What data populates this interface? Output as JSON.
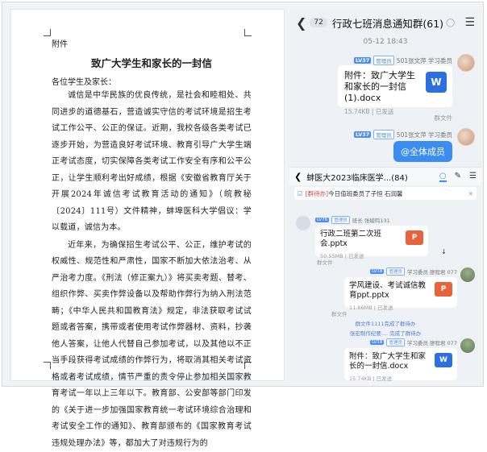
{
  "document": {
    "attachment_label": "附件",
    "title": "致广大学生和家长的一封信",
    "greeting": "各位学生及家长：",
    "paragraphs": [
      "诚信是中华民族的优良传统，是社会和睦相处、共同进步的道德基石，营造诚实守信的考试环境是招生考试工作公平、公正的保证。近期，我校各级各类考试已逐步开始，为营造良好考试环境、教育引导广大学生端正考试态度，切实保障各类考试工作安全有序和公平公正，让学生顺利考出好成绩，根据《安徽省教育厅关于开展2024年诚信考试教育活动的通知》（皖教秘〔2024〕111号）文件精神，蚌埠医科大学倡议：学以载道，诚信为本。",
      "近年来，为确保招生考试公平、公正，维护考试的权威性、规范性和严肃性，国家不断加大依法治考、从严治考力度。《刑法（修正案九）》将买卖考题、替考、组织作弊、买卖作弊设备以及帮助作弊行为纳入刑法范畴；《中华人民共和国教育法》规定，非法获取考试试题或者答案，携带或者使用考试作弊器材、资料，抄袭他人答案，让他人代替自己参加考试，以及其他以不正当手段获得考试成绩的作弊行为，将取消其相关考试资格或者考试成绩，情节严重的责令停止参加相关国家教育考试一年以上三年以下。教育部、公安部等部门印发的《关于进一步加强国家教育统一考试环境综合治理和考试安全工作的通知》、教育部颁布的《国家教育考试违规处理办法》等，都加大了对违规行为的"
    ]
  },
  "chat1": {
    "unread": "72",
    "title": "行政七班消息通知群(61)",
    "timestamp": "05-12 18:43",
    "sender": {
      "level": "LV37",
      "role": "管理员",
      "name": "501张文萍 学习委员"
    },
    "file": {
      "name": "附件：致广大学生和家长的一封信(1).docx",
      "size": "15.74KB",
      "status": "已发送"
    },
    "group_file_label": "群文件",
    "mention": "@全体成员"
  },
  "chat2": {
    "title": "蚌医大2023临床医学...(84)",
    "notice": {
      "tag": "[群待办]",
      "text": "今日值班委员了子恒 石润馨"
    },
    "msg1": {
      "level": "LV76",
      "role": "管理员",
      "name": "班长 张峻鸣131",
      "file_name": "行政二班第二次班会.pptx",
      "size": "50.55MB",
      "status": "已发送"
    },
    "group_file": "群文件",
    "msg2": {
      "level": "LV18",
      "role": "管理员",
      "name": "学习委员 廖程君 077",
      "file_name": "学风建设、考试诚信教育ppt.pptx",
      "size": "11.66MB",
      "status": "已发送"
    },
    "sys1": "群文件1111完成了群待办",
    "sys2": "张宏制作纪要.... 完成了群待办",
    "msg3": {
      "level": "LV18",
      "role": "管理员",
      "name": "学习委员 廖程君 077",
      "file_name": "附件：致广大学生和家长的一封信.docx",
      "size": "15.74KB",
      "status": "已发送"
    }
  },
  "colors": {
    "accent": "#3b8ef0",
    "word": "#2c6fe0",
    "ppt": "#e8623c"
  }
}
